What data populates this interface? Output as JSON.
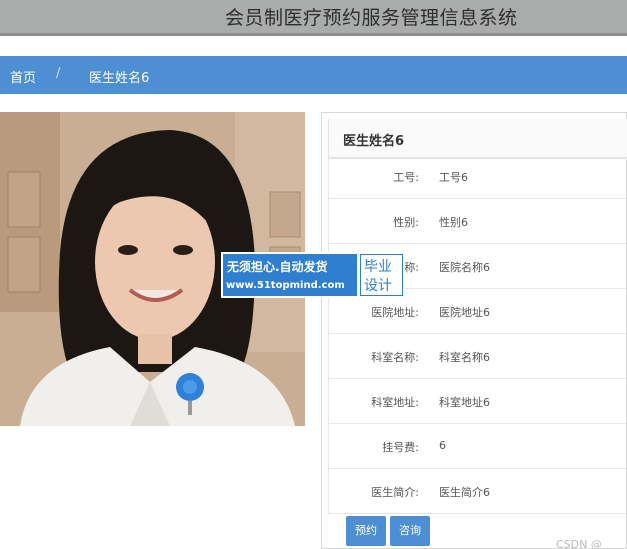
{
  "header": {
    "title": "会员制医疗预约服务管理信息系统"
  },
  "nav": {
    "home": "首页",
    "current": "医生姓名6"
  },
  "doctor": {
    "name": "医生姓名6",
    "fields": [
      {
        "label": "工号:",
        "value": "工号6"
      },
      {
        "label": "性别:",
        "value": "性别6"
      },
      {
        "label": "医院名称:",
        "value": "医院名称6"
      },
      {
        "label": "医院地址:",
        "value": "医院地址6"
      },
      {
        "label": "科室名称:",
        "value": "科室名称6"
      },
      {
        "label": "科室地址:",
        "value": "科室地址6"
      },
      {
        "label": "挂号费:",
        "value": "6"
      },
      {
        "label": "医生简介:",
        "value": "医生简介6"
      }
    ]
  },
  "actions": {
    "book": "预约",
    "consult": "咨询"
  },
  "watermark": {
    "line1": "无须担心.自动发货",
    "line2": "www.51topmind.com",
    "right1": "毕业",
    "right2": "设计"
  },
  "footer": {
    "mark": "CSDN @"
  },
  "colors": {
    "primary": "#4e8fd4",
    "topbar": "#a9acab",
    "watermark": "#2f7fd0"
  }
}
